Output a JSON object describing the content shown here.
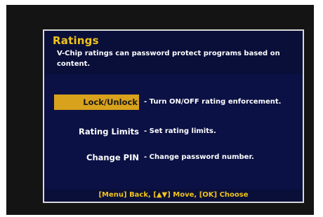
{
  "panel": {
    "title": "Ratings",
    "description": "V-Chip ratings can password protect programs based on content."
  },
  "menu": {
    "items": [
      {
        "label": "Lock/Unlock",
        "description": "- Turn ON/OFF rating enforcement.",
        "selected": true
      },
      {
        "label": "Rating Limits",
        "description": "- Set rating limits.",
        "selected": false
      },
      {
        "label": "Change PIN",
        "description": "- Change password number.",
        "selected": false
      }
    ]
  },
  "footer": {
    "hint": "[Menu] Back, [▲▼] Move, [OK] Choose"
  },
  "colors": {
    "panel_background": "#0b1144",
    "title": "#f0c419",
    "highlight": "#d9a21d",
    "frame_border": "#d8d8d8"
  }
}
